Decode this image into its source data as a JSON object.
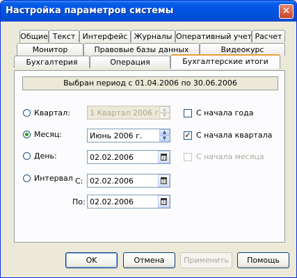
{
  "window": {
    "title": "Настройка параметров системы",
    "close_glyph": "✕"
  },
  "tabs": {
    "row1": [
      "Общие",
      "Текст",
      "Интерфейс",
      "Журналы",
      "Оперативный учет",
      "Расчет"
    ],
    "row2": [
      "Монитор",
      "Правовые базы данных",
      "Видеокурс"
    ],
    "row3": [
      "Бухгалтерия",
      "Операция",
      "Бухгалтерские итоги"
    ],
    "active": "Бухгалтерские итоги"
  },
  "period_text": "Выбран период с 01.04.2006 по 30.06.2006",
  "options": {
    "quarter": {
      "label": "Квартал:",
      "value": "1 Квартал 2006 г.",
      "selected": false,
      "enabled": false
    },
    "month": {
      "label": "Месяц:",
      "value": "Июнь 2006 г.",
      "selected": true,
      "enabled": true
    },
    "day": {
      "label": "День:",
      "value": "02.02.2006",
      "selected": false
    },
    "interval": {
      "label": "Интервал",
      "from_label": "С:",
      "from_value": "02.02.2006",
      "to_label": "По:",
      "to_value": "02.02.2006",
      "selected": false
    }
  },
  "checkboxes": {
    "from_year_start": {
      "label": "С начала года",
      "checked": false,
      "enabled": true
    },
    "from_quarter_start": {
      "label": "С начала квартала",
      "checked": true,
      "enabled": true
    },
    "from_month_start": {
      "label": "С начала месяца",
      "checked": false,
      "enabled": false
    }
  },
  "buttons": {
    "ok": "OK",
    "cancel": "Отмена",
    "apply": "Применить",
    "help": "Помощь"
  },
  "icons": {
    "check_glyph": "✓",
    "spin_up": "▲",
    "spin_down": "▼"
  }
}
